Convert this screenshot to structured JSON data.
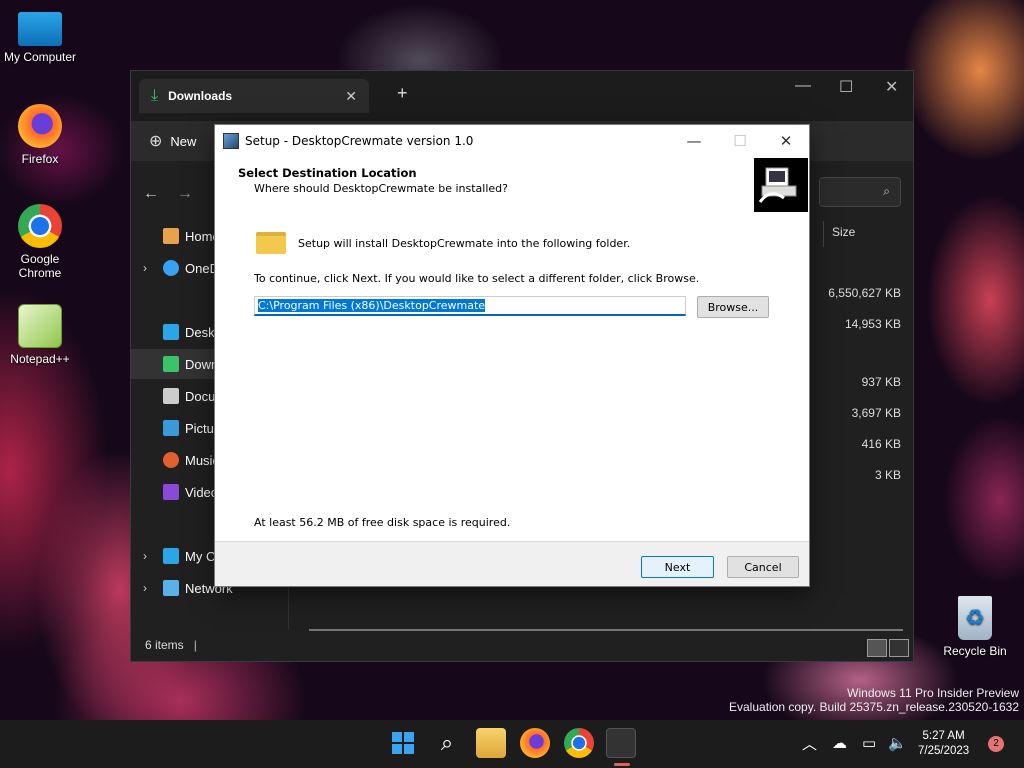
{
  "desktop": {
    "icons": [
      {
        "label": "My Computer",
        "icon": "monitor-icon"
      },
      {
        "label": "Firefox",
        "icon": "firefox-icon"
      },
      {
        "label": "Google Chrome",
        "icon": "chrome-icon"
      },
      {
        "label": "Notepad++",
        "icon": "notepadpp-icon"
      },
      {
        "label": "Recycle Bin",
        "icon": "recycle-bin-icon"
      }
    ],
    "watermark": [
      "Windows 11 Pro Insider Preview",
      "Evaluation copy. Build 25375.zn_release.230520-1632"
    ]
  },
  "explorer": {
    "tab_title": "Downloads",
    "new_tab": "+",
    "toolbar_new": "New",
    "nav": [
      "Home",
      "OneD",
      "Deskt",
      "Down",
      "Docu",
      "Pictur",
      "Music",
      "Video",
      "My C",
      "Network"
    ],
    "column_header": "Size",
    "sizes": [
      "6,550,627 KB",
      "14,953 KB",
      "937 KB",
      "3,697 KB",
      "416 KB",
      "3 KB"
    ],
    "status": "6 items"
  },
  "setup": {
    "title": "Setup - DesktopCrewmate version 1.0",
    "heading": "Select Destination Location",
    "subheading": "Where should DesktopCrewmate be installed?",
    "install_text": "Setup will install DesktopCrewmate into the following folder.",
    "continue_text": "To continue, click Next. If you would like to select a different folder, click Browse.",
    "path": "C:\\Program Files (x86)\\DesktopCrewmate",
    "browse_label": "Browse...",
    "disk_text": "At least 56.2 MB of free disk space is required.",
    "next_label": "Next",
    "cancel_label": "Cancel"
  },
  "taskbar": {
    "time": "5:27 AM",
    "date": "7/25/2023",
    "notification_count": "2"
  }
}
